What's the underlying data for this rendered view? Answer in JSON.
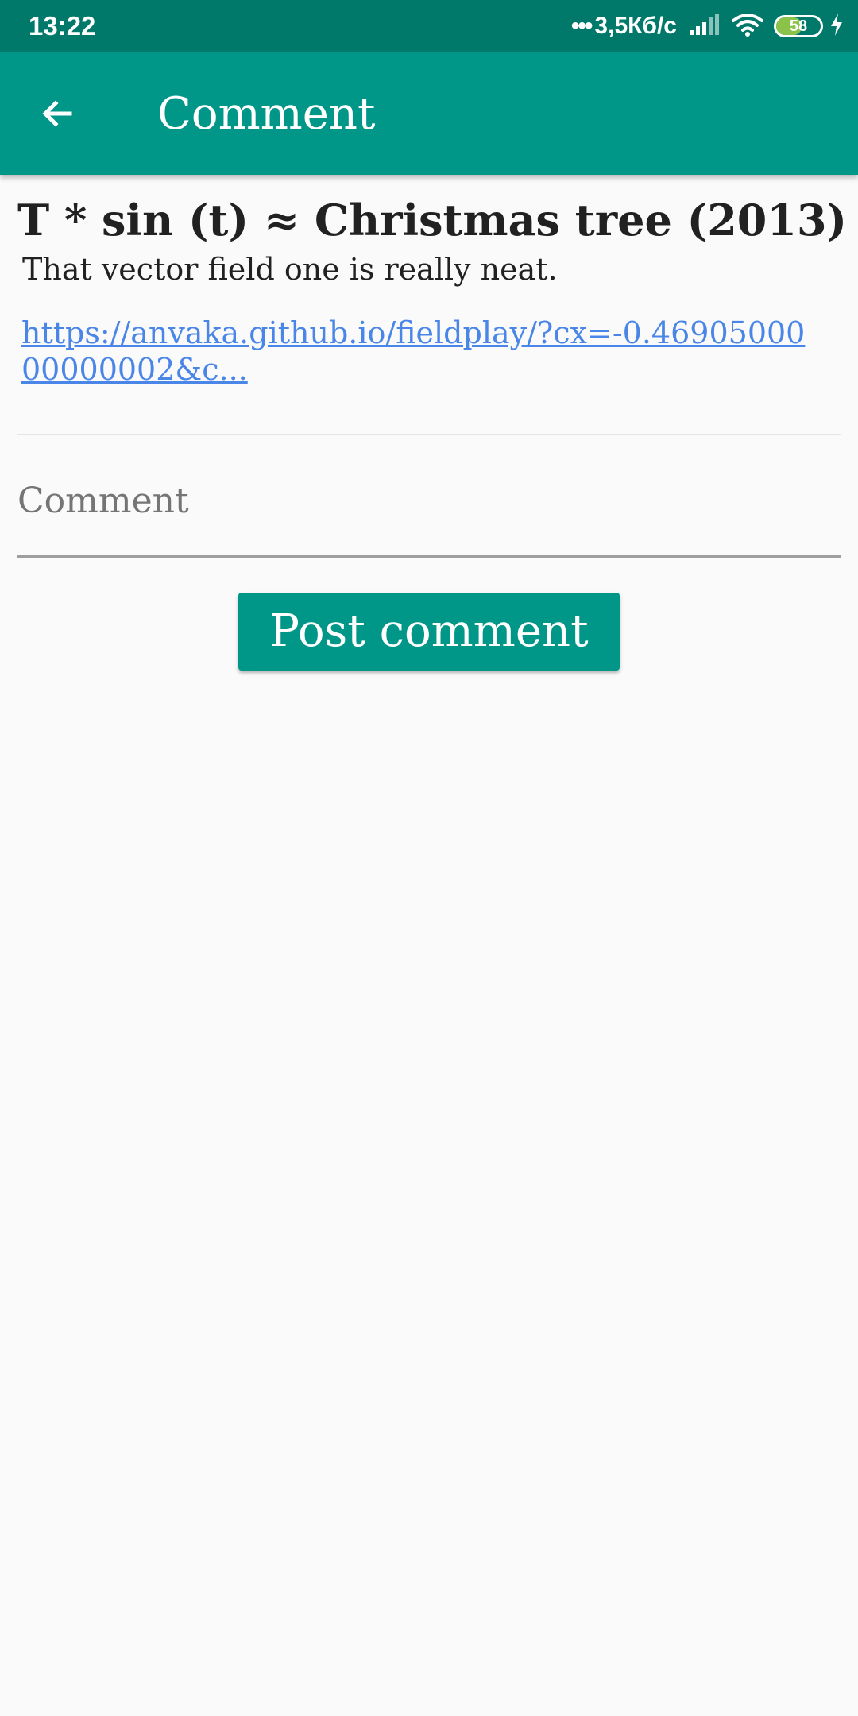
{
  "status_bar": {
    "time": "13:22",
    "network_speed": "3,5Кб/с",
    "battery_level": "58",
    "battery_fraction": 0.58,
    "icons": [
      "signal-icon",
      "wifi-icon",
      "battery-icon",
      "charging-icon"
    ]
  },
  "app_bar": {
    "title": "Comment",
    "back_icon": "arrow-back-icon"
  },
  "post": {
    "title": "T * sin (t) ≈ Christmas tree (2013)",
    "body": "That vector field one is really neat.",
    "link": "https://anvaka.github.io/fieldplay/?cx=-0.4690500000000002&c..."
  },
  "comment_form": {
    "placeholder": "Comment",
    "value": "",
    "submit_label": "Post comment"
  },
  "colors": {
    "status_bar": "#00796b",
    "app_bar": "#009688",
    "accent": "#009688",
    "link": "#4a86e8",
    "battery": "#8bc34a"
  }
}
